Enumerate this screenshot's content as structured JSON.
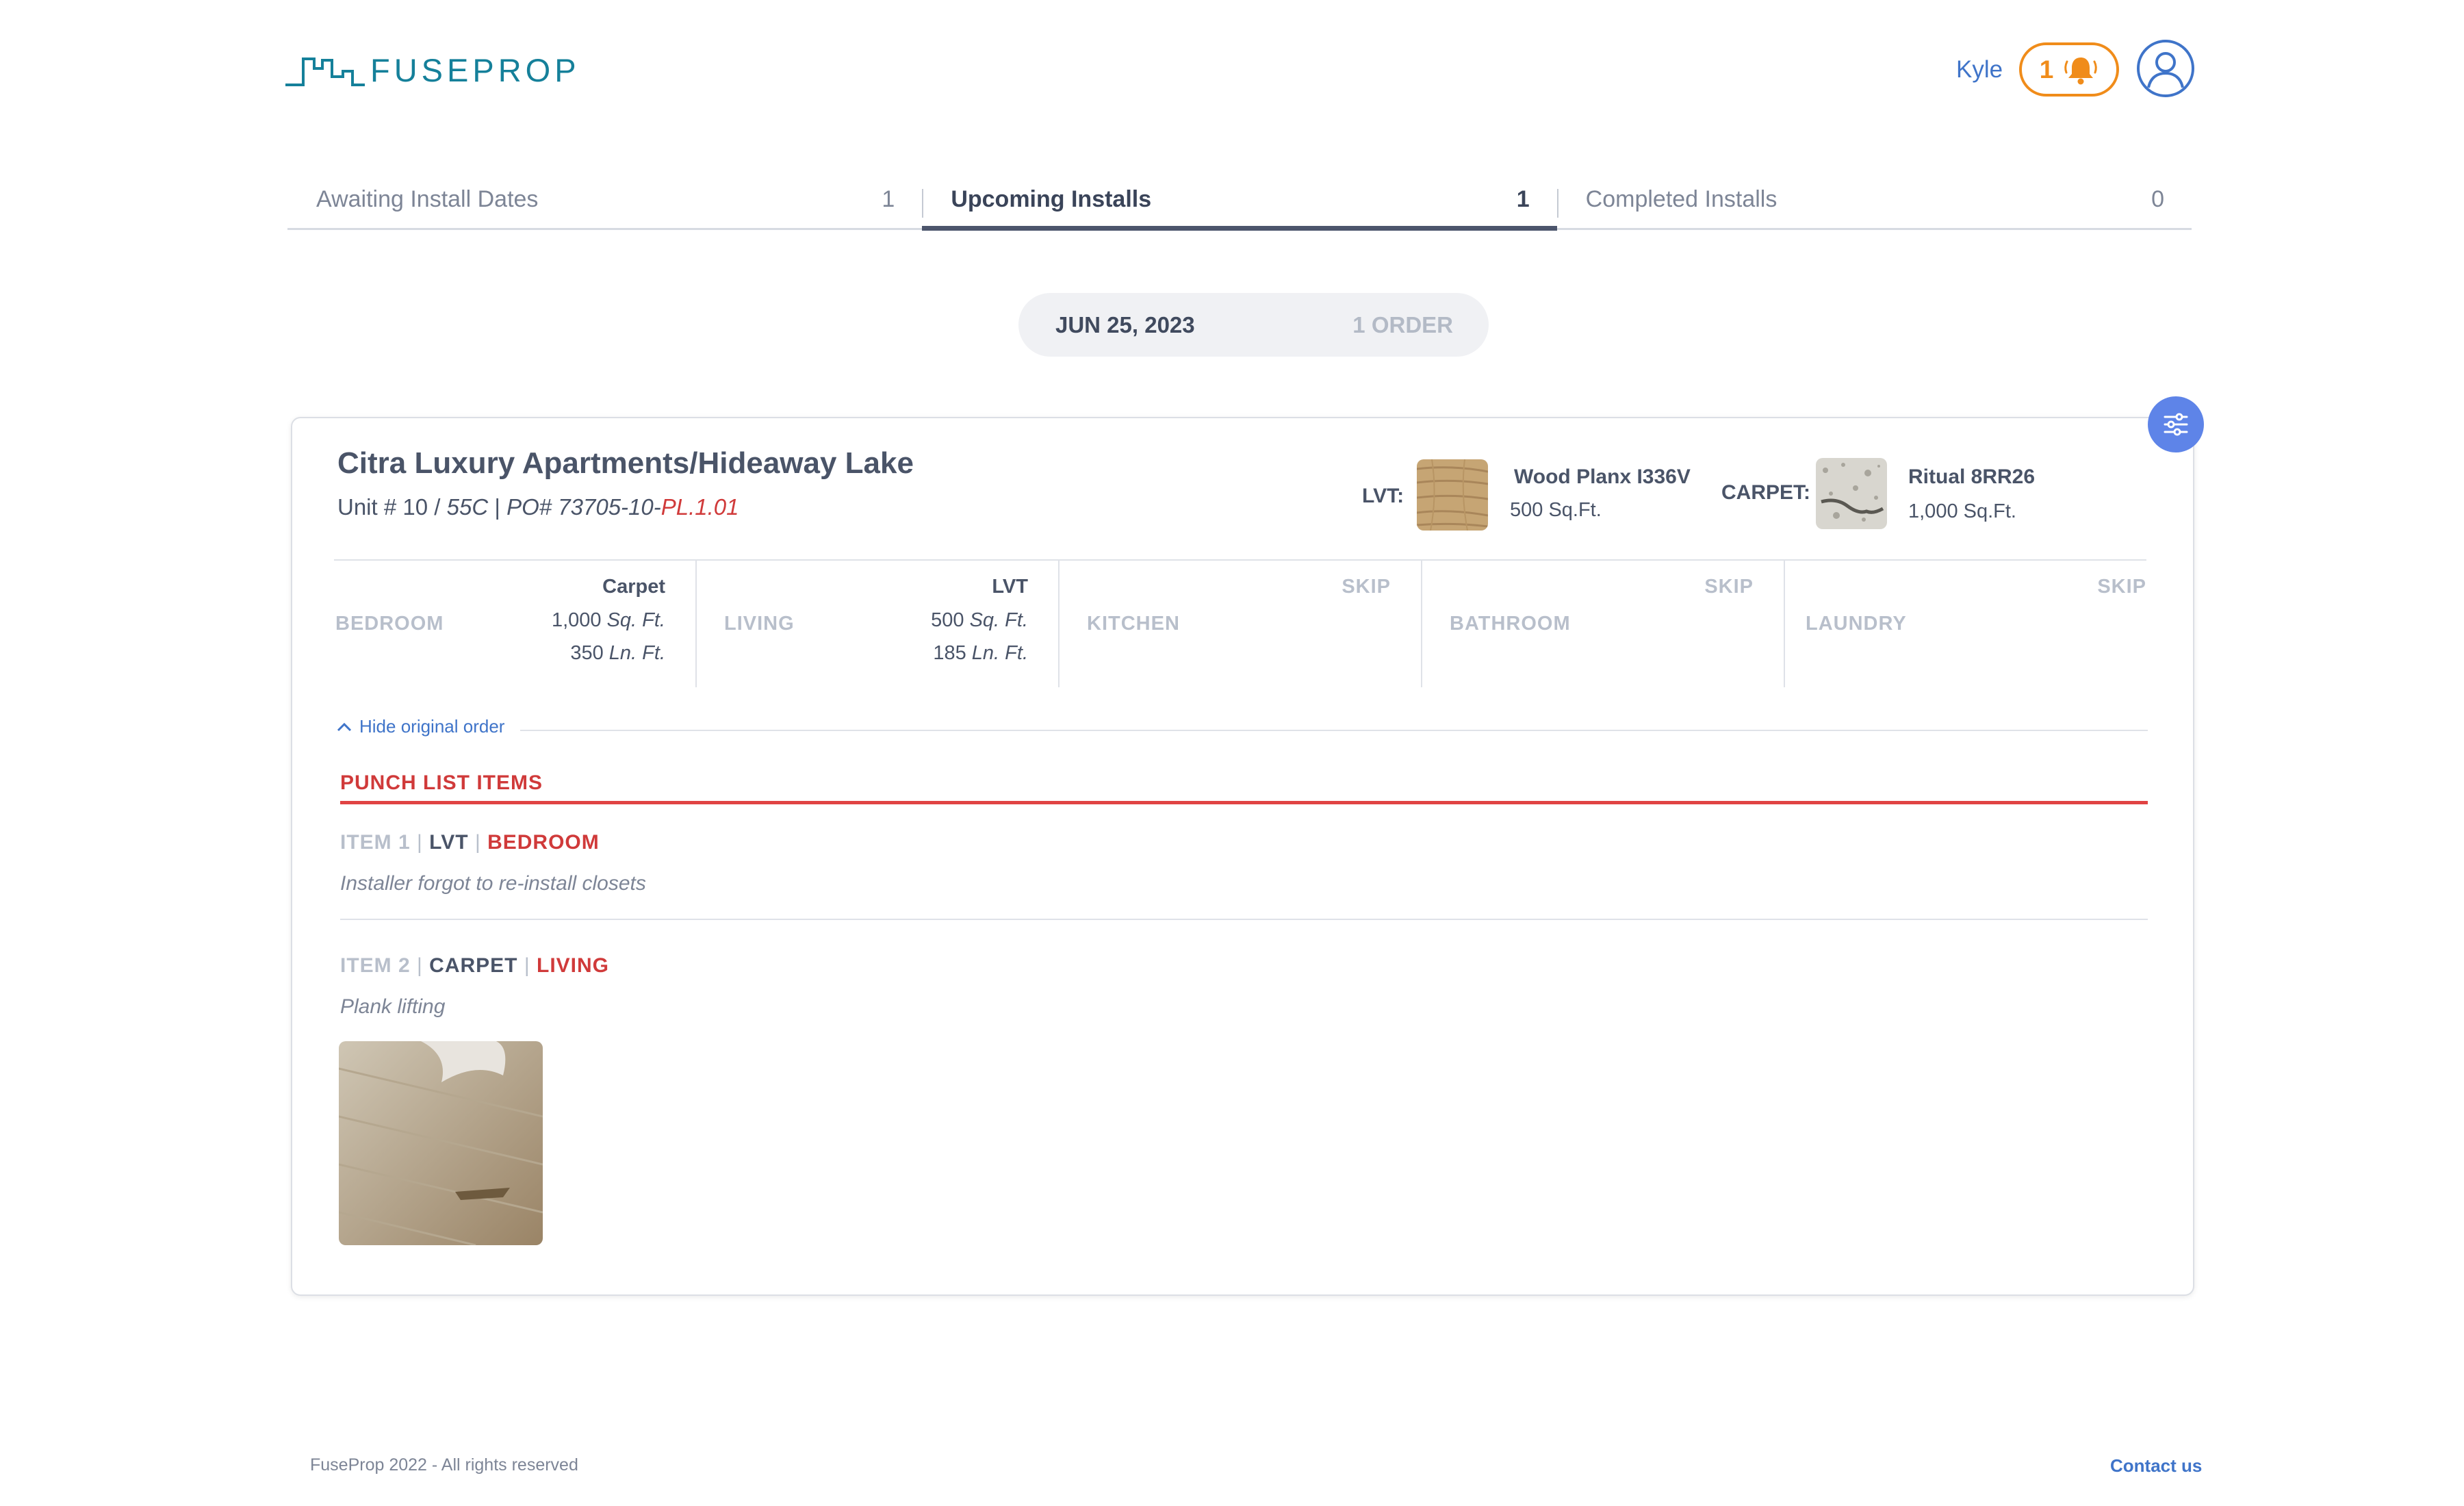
{
  "header": {
    "logo_text": "FUSEPROP",
    "user_name": "Kyle",
    "notification_count": "1"
  },
  "tabs": [
    {
      "label": "Awaiting Install Dates",
      "count": "1",
      "active": false
    },
    {
      "label": "Upcoming Installs",
      "count": "1",
      "active": true
    },
    {
      "label": "Completed Installs",
      "count": "0",
      "active": false
    }
  ],
  "date_group": {
    "date": "JUN 25, 2023",
    "orders": "1 ORDER"
  },
  "order": {
    "property": "Citra Luxury Apartments/Hideaway Lake",
    "unit_prefix": "Unit #",
    "unit_number": "10",
    "unit_slash": "/",
    "unit_code": "55C",
    "po_separator": "|",
    "po_prefix": "PO# 73705-10-",
    "po_suffix": "PL.1.01",
    "materials": [
      {
        "label": "LVT:",
        "name": "Wood Planx I336V",
        "qty": "500 Sq.Ft."
      },
      {
        "label": "CARPET:",
        "name": "Ritual 8RR26",
        "qty": "1,000 Sq.Ft."
      }
    ],
    "rooms": [
      {
        "name": "BEDROOM",
        "material": "Carpet",
        "q1_num": "1,000",
        "q1_unit": "Sq. Ft.",
        "q2_num": "350",
        "q2_unit": "Ln. Ft."
      },
      {
        "name": "LIVING",
        "material": "LVT",
        "q1_num": "500",
        "q1_unit": "Sq. Ft.",
        "q2_num": "185",
        "q2_unit": "Ln. Ft."
      },
      {
        "name": "KITCHEN",
        "material": "SKIP"
      },
      {
        "name": "BATHROOM",
        "material": "SKIP"
      },
      {
        "name": "LAUNDRY",
        "material": "SKIP"
      }
    ],
    "hide_link": "Hide original order"
  },
  "punch_list": {
    "title": "PUNCH LIST ITEMS",
    "separator": "|",
    "items": [
      {
        "number": "ITEM 1",
        "material": "LVT",
        "room": "BEDROOM",
        "description": "Installer forgot to re-install closets"
      },
      {
        "number": "ITEM 2",
        "material": "CARPET",
        "room": "LIVING",
        "description": "Plank lifting"
      }
    ]
  },
  "footer": {
    "copyright": "FuseProp 2022 - All rights reserved",
    "contact": "Contact us"
  },
  "colors": {
    "accent": "#3f74c9",
    "notification": "#f08c1a",
    "alert": "#d03a3a",
    "filter_button": "#5e84e8"
  },
  "icons": [
    "city-skyline-logo-icon",
    "bell-icon",
    "user-avatar-icon",
    "filter-sliders-icon",
    "chevron-up-icon"
  ]
}
